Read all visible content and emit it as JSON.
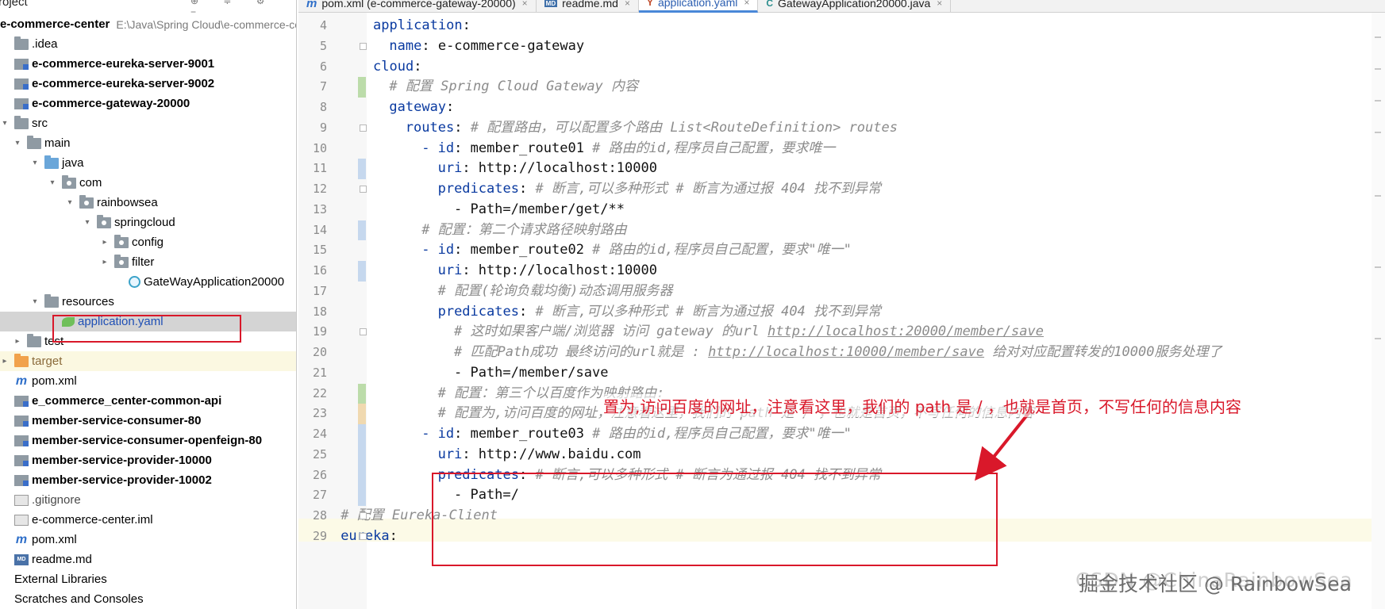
{
  "tabs": [
    {
      "label": "pom.xml (e-commerce-gateway-20000)",
      "icon": "maven-icon",
      "active": false
    },
    {
      "label": "readme.md",
      "icon": "markdown-icon",
      "active": false
    },
    {
      "label": "application.yaml",
      "icon": "yaml-icon",
      "active": true
    },
    {
      "label": "GatewayApplication20000.java",
      "icon": "java-class-icon",
      "active": false
    }
  ],
  "project": {
    "header": "Project",
    "root_name": "e-commerce-center",
    "root_path": "E:\\Java\\Spring Cloud\\e-commerce-center",
    "tree": [
      {
        "label": ".idea",
        "icon": "folder-icon"
      },
      {
        "label": "e-commerce-eureka-server-9001",
        "icon": "module-icon"
      },
      {
        "label": "e-commerce-eureka-server-9002",
        "icon": "module-icon"
      },
      {
        "label": "e-commerce-gateway-20000",
        "icon": "module-icon"
      },
      {
        "label": "src",
        "icon": "folder-icon"
      },
      {
        "label": "main",
        "icon": "folder-icon"
      },
      {
        "label": "java",
        "icon": "source-folder-icon"
      },
      {
        "label": "com",
        "icon": "package-icon"
      },
      {
        "label": "rainbowsea",
        "icon": "package-icon"
      },
      {
        "label": "springcloud",
        "icon": "package-icon"
      },
      {
        "label": "config",
        "icon": "package-icon"
      },
      {
        "label": "filter",
        "icon": "package-icon"
      },
      {
        "label": "GateWayApplication20000",
        "icon": "java-class-icon"
      },
      {
        "label": "resources",
        "icon": "resources-folder-icon"
      },
      {
        "label": "application.yaml",
        "icon": "spring-yaml-icon"
      },
      {
        "label": "test",
        "icon": "folder-icon"
      },
      {
        "label": "target",
        "icon": "excluded-folder-icon"
      },
      {
        "label": "pom.xml",
        "icon": "maven-icon"
      },
      {
        "label": "e_commerce_center-common-api",
        "icon": "module-icon"
      },
      {
        "label": "member-service-consumer-80",
        "icon": "module-icon"
      },
      {
        "label": "member-service-consumer-openfeign-80",
        "icon": "module-icon"
      },
      {
        "label": "member-service-provider-10000",
        "icon": "module-icon"
      },
      {
        "label": "member-service-provider-10002",
        "icon": "module-icon"
      },
      {
        "label": ".gitignore",
        "icon": "gitignore-icon"
      },
      {
        "label": "e-commerce-center.iml",
        "icon": "iml-icon"
      },
      {
        "label": "pom.xml",
        "icon": "maven-icon"
      },
      {
        "label": "readme.md",
        "icon": "markdown-icon"
      },
      {
        "label": "External Libraries",
        "icon": "library-icon"
      },
      {
        "label": "Scratches and Consoles",
        "icon": "scratches-icon"
      }
    ]
  },
  "editor": {
    "lines": [
      {
        "num": "4",
        "parts": [
          [
            "k",
            "application"
          ],
          [
            "p",
            ":"
          ]
        ]
      },
      {
        "num": "5",
        "parts": [
          [
            "k",
            "name"
          ],
          [
            "p",
            ": "
          ],
          [
            "v",
            "e-commerce-gateway"
          ]
        ]
      },
      {
        "num": "6",
        "parts": [
          [
            "k",
            "cloud"
          ],
          [
            "p",
            ":"
          ]
        ]
      },
      {
        "num": "7",
        "parts": [
          [
            "c",
            "# 配置 Spring Cloud Gateway 内容"
          ]
        ]
      },
      {
        "num": "8",
        "parts": [
          [
            "k",
            "gateway"
          ],
          [
            "p",
            ":"
          ]
        ]
      },
      {
        "num": "9",
        "parts": [
          [
            "k",
            "routes"
          ],
          [
            "p",
            ": "
          ],
          [
            "c",
            "# 配置路由，可以配置多个路由 List<RouteDefinition> routes"
          ]
        ]
      },
      {
        "num": "10",
        "parts": [
          [
            "d",
            "- "
          ],
          [
            "k",
            "id"
          ],
          [
            "p",
            ": "
          ],
          [
            "v",
            "member_route01 "
          ],
          [
            "c",
            "# 路由的id,程序员自己配置，要求唯一"
          ]
        ]
      },
      {
        "num": "11",
        "parts": [
          [
            "k",
            "uri"
          ],
          [
            "p",
            ": "
          ],
          [
            "v",
            "http://localhost:10000"
          ]
        ]
      },
      {
        "num": "12",
        "parts": [
          [
            "k",
            "predicates"
          ],
          [
            "p",
            ": "
          ],
          [
            "c",
            "# 断言,可以多种形式 # 断言为通过报 404 找不到异常"
          ]
        ]
      },
      {
        "num": "13",
        "parts": [
          [
            "v",
            "- Path=/member/get/**"
          ]
        ]
      },
      {
        "num": "14",
        "parts": [
          [
            "c",
            "# 配置：第二个请求路径映射路由"
          ]
        ]
      },
      {
        "num": "15",
        "parts": [
          [
            "d",
            "- "
          ],
          [
            "k",
            "id"
          ],
          [
            "p",
            ": "
          ],
          [
            "v",
            "member_route02 "
          ],
          [
            "c",
            "# 路由的id,程序员自己配置，要求\"唯一\""
          ]
        ]
      },
      {
        "num": "16",
        "parts": [
          [
            "k",
            "uri"
          ],
          [
            "p",
            ": "
          ],
          [
            "v",
            "http://localhost:10000"
          ]
        ]
      },
      {
        "num": "17",
        "parts": [
          [
            "c",
            "# 配置(轮询负载均衡)动态调用服务器"
          ]
        ]
      },
      {
        "num": "18",
        "parts": [
          [
            "k",
            "predicates"
          ],
          [
            "p",
            ": "
          ],
          [
            "c",
            "# 断言,可以多种形式 # 断言为通过报 404 找不到异常"
          ]
        ]
      },
      {
        "num": "19",
        "parts": [
          [
            "c",
            "# 这时如果客户端/浏览器 访问 gateway 的url "
          ],
          [
            "u",
            "http://localhost:20000/member/save"
          ]
        ]
      },
      {
        "num": "20",
        "parts": [
          [
            "c",
            "# 匹配Path成功 最终访问的url就是 : "
          ],
          [
            "u",
            "http://localhost:10000/member/save"
          ],
          [
            "c",
            " 给对对应配置转发的10000服务处理了"
          ]
        ]
      },
      {
        "num": "21",
        "parts": [
          [
            "v",
            "- Path=/member/save"
          ]
        ]
      },
      {
        "num": "22",
        "parts": [
          [
            "c",
            "# 配置：第三个以百度作为映射路由:"
          ]
        ]
      },
      {
        "num": "23",
        "parts": [
          [
            "c",
            "# 配置为,访问百度的网址，注意看这里，我们的 path 是 / ，也就是首页，不写任何的信息内容"
          ]
        ]
      },
      {
        "num": "24",
        "parts": [
          [
            "d",
            "- "
          ],
          [
            "k",
            "id"
          ],
          [
            "p",
            ": "
          ],
          [
            "v",
            "member_route03 "
          ],
          [
            "c",
            "# 路由的id,程序员自己配置，要求\"唯一\""
          ]
        ]
      },
      {
        "num": "25",
        "parts": [
          [
            "k",
            "uri"
          ],
          [
            "p",
            ": "
          ],
          [
            "v",
            "http://www.baidu.com"
          ]
        ]
      },
      {
        "num": "26",
        "parts": [
          [
            "k",
            "predicates"
          ],
          [
            "p",
            ": "
          ],
          [
            "c",
            "# 断言,可以多种形式 # 断言为通过报 404 找不到异常"
          ]
        ]
      },
      {
        "num": "27",
        "parts": [
          [
            "v",
            "- Path=/"
          ]
        ]
      },
      {
        "num": "28",
        "parts": [
          [
            "c",
            "# 配置 Eureka-Client"
          ]
        ]
      },
      {
        "num": "29",
        "parts": [
          [
            "k",
            "eureka"
          ],
          [
            "p",
            ":"
          ]
        ]
      }
    ]
  },
  "annotation": {
    "note": "置为,访问百度的网址，注意看这里，我们的 path 是 / ，也就是首页，不写任何的信息内容",
    "color": "#d9182a"
  },
  "watermark": "掘金技术社区 @ RainbowSea",
  "watermark_behind": "CSDN @ChinaRainbowSea"
}
